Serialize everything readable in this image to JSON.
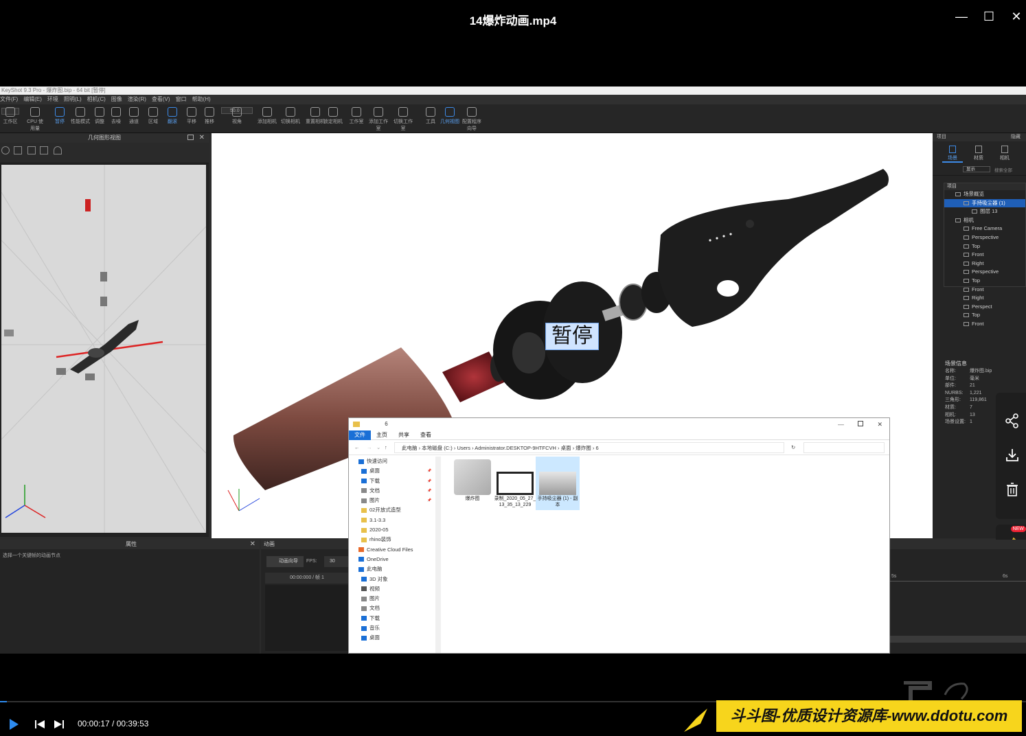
{
  "player": {
    "title": "14爆炸动画.mp4",
    "minimize": "—",
    "maximize": "☐",
    "close": "✕",
    "current_time": "00:00:17",
    "total_time": "00:39:53",
    "time_separator": " / ",
    "progress_fraction": 0.007
  },
  "keyshot": {
    "window_title": "KeyShot 9.3 Pro - 爆炸图.bip - 64 bit [暂停]",
    "menu": [
      "文件(F)",
      "编辑(E)",
      "环境",
      "照明(L)",
      "相机(C)",
      "图像",
      "渲染(R)",
      "查看(V)",
      "窗口",
      "帮助(H)"
    ],
    "ribbon": [
      {
        "label": "工作区"
      },
      {
        "label": "CPU 使用量"
      },
      {
        "label": "暂停",
        "active": true
      },
      {
        "label": "性能模式"
      },
      {
        "label": "调整"
      },
      {
        "label": "去噪"
      },
      {
        "label": "通道"
      },
      {
        "label": "区域"
      },
      {
        "label": "翻滚",
        "active": true
      },
      {
        "label": "平移"
      },
      {
        "label": "推移"
      },
      {
        "label": "视角"
      },
      {
        "label": "添加相机"
      },
      {
        "label": "切换相机"
      },
      {
        "label": "重置相机"
      },
      {
        "label": "锁定相机"
      },
      {
        "label": "工作室"
      },
      {
        "label": "添加工作室"
      },
      {
        "label": "切换工作室"
      },
      {
        "label": "工具"
      },
      {
        "label": "几何视图",
        "active": true
      },
      {
        "label": "配置程序向导"
      }
    ],
    "geometry_panel_title": "几何图形视图",
    "fov_value": "50.0",
    "pause_label": "暂停",
    "right_panel": {
      "header": "项目",
      "header_right": "隐藏",
      "tabs": [
        "场景",
        "材质",
        "相机"
      ],
      "show_btn": "显示",
      "search_placeholder": "搜索全部",
      "tree_header": "项目",
      "tree": [
        {
          "label": "场景概览",
          "indent": 1
        },
        {
          "label": "手持吸尘器 (1)",
          "indent": 2,
          "selected": true
        },
        {
          "label": "图层 13",
          "indent": 3
        },
        {
          "label": "相机",
          "indent": 1
        },
        {
          "label": "Free Camera",
          "indent": 2
        },
        {
          "label": "Perspective",
          "indent": 2
        },
        {
          "label": "Top",
          "indent": 2
        },
        {
          "label": "Front",
          "indent": 2
        },
        {
          "label": "Right",
          "indent": 2
        },
        {
          "label": "Perspective",
          "indent": 2
        },
        {
          "label": "Top",
          "indent": 2
        },
        {
          "label": "Front",
          "indent": 2
        },
        {
          "label": "Right",
          "indent": 2
        },
        {
          "label": "Perspect",
          "indent": 2
        },
        {
          "label": "Top",
          "indent": 2
        },
        {
          "label": "Front",
          "indent": 2
        }
      ],
      "scene_info_title": "场景信息",
      "scene_info": [
        {
          "k": "名称:",
          "v": "爆炸图.bip"
        },
        {
          "k": "单位:",
          "v": "毫米"
        },
        {
          "k": "部件:",
          "v": "21"
        },
        {
          "k": "NURBS:",
          "v": "1,221"
        },
        {
          "k": "三角形:",
          "v": "119,861"
        },
        {
          "k": "材质:",
          "v": "7"
        },
        {
          "k": "相机:",
          "v": "13"
        },
        {
          "k": "场景设置:",
          "v": "1"
        }
      ]
    },
    "bottom_left_title": "属性",
    "bottom_left_hint": "选择一个关键帧的动画节点",
    "anim_title": "动画",
    "anim_button": "动画向导",
    "fps_label": "FPS:",
    "fps_value": "30",
    "timecode": "00:00:000 / 帧 1",
    "ruler_ticks": [
      "5s",
      "6s"
    ]
  },
  "explorer": {
    "title": "6",
    "tabs": [
      "文件",
      "主页",
      "共享",
      "查看"
    ],
    "path": [
      "此电脑",
      "本地磁盘 (C:)",
      "Users",
      "Administrator.DESKTOP-9HTFCVH",
      "桌面",
      "爆炸图",
      "6"
    ],
    "nav": [
      {
        "label": "快速访问",
        "pin": false,
        "icon": "star"
      },
      {
        "label": "桌面",
        "pin": true,
        "icon": "desktop"
      },
      {
        "label": "下载",
        "pin": true,
        "icon": "download"
      },
      {
        "label": "文档",
        "pin": true,
        "icon": "doc"
      },
      {
        "label": "图片",
        "pin": true,
        "icon": "pic"
      },
      {
        "label": "02开放式造型",
        "pin": false,
        "icon": "folder"
      },
      {
        "label": "3.1-3.3",
        "pin": false,
        "icon": "folder"
      },
      {
        "label": "2020-05",
        "pin": false,
        "icon": "folder"
      },
      {
        "label": "rhino装饰",
        "pin": false,
        "icon": "folder"
      },
      {
        "label": "Creative Cloud Files",
        "pin": false,
        "icon": "cc"
      },
      {
        "label": "OneDrive",
        "pin": false,
        "icon": "cloud"
      },
      {
        "label": "此电脑",
        "pin": false,
        "icon": "pc"
      },
      {
        "label": "3D 对象",
        "pin": false,
        "icon": "3d"
      },
      {
        "label": "视频",
        "pin": false,
        "icon": "video"
      },
      {
        "label": "图片",
        "pin": false,
        "icon": "pic"
      },
      {
        "label": "文档",
        "pin": false,
        "icon": "doc"
      },
      {
        "label": "下载",
        "pin": false,
        "icon": "download"
      },
      {
        "label": "音乐",
        "pin": false,
        "icon": "music"
      },
      {
        "label": "桌面",
        "pin": false,
        "icon": "desktop"
      }
    ],
    "files": [
      {
        "label": "爆炸图",
        "kind": "keyshot"
      },
      {
        "label": "录制_2020_05_27_13_35_13_229",
        "kind": "video"
      },
      {
        "label": "手持吸尘器 (1) - 副本",
        "kind": "image",
        "selected": true
      }
    ]
  },
  "watermark": "斗斗图-优质设计资源库-www.ddotu.com",
  "side_actions": {
    "new_badge": "NEW"
  }
}
